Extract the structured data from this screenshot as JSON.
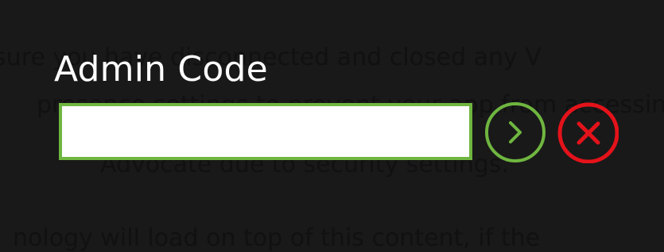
{
  "background_text": [
    "sure you have disconnected and closed any V",
    "presence settings to prevent your app from accessin",
    "Advocate due to security settings.",
    "nology will load on top of this content, if the"
  ],
  "admin_code": {
    "label": "Admin Code",
    "value": "",
    "placeholder": ""
  },
  "buttons": {
    "submit_icon": "chevron-right-circle-icon",
    "cancel_icon": "x-circle-icon"
  },
  "colors": {
    "background": "#191919",
    "accent_green": "#6fb640",
    "cancel_red": "#e4121a",
    "label_text": "#ffffff"
  }
}
